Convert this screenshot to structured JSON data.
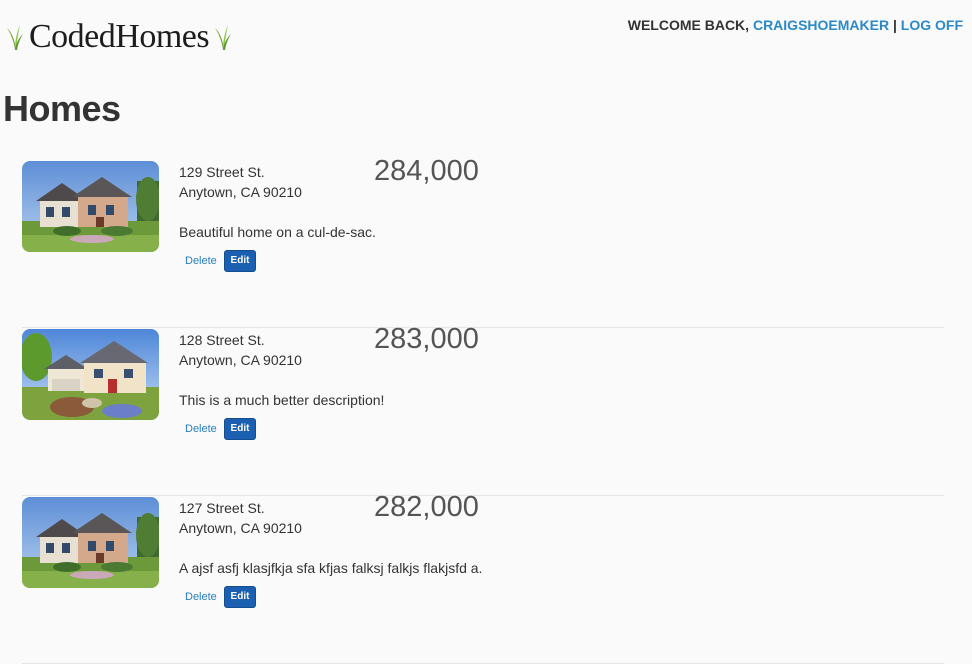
{
  "header": {
    "logo_text": "CodedHomes",
    "welcome_text": "WELCOME BACK,",
    "username": "CRAIGSHOEMAKER",
    "separator": "|",
    "logoff_label": "LOG OFF"
  },
  "page": {
    "title": "Homes"
  },
  "homes": [
    {
      "street": "129 Street St.",
      "city_line": "Anytown, CA 90210",
      "price": "284,000",
      "description": "Beautiful home on a cul-de-sac.",
      "delete_label": "Delete",
      "edit_label": "Edit",
      "image": "house-photo-1"
    },
    {
      "street": "128 Street St.",
      "city_line": "Anytown, CA 90210",
      "price": "283,000",
      "description": "This is a much better description!",
      "delete_label": "Delete",
      "edit_label": "Edit",
      "image": "house-photo-2"
    },
    {
      "street": "127 Street St.",
      "city_line": "Anytown, CA 90210",
      "price": "282,000",
      "description": "A ajsf asfj klasjfkja sfa kfjas falksj falkjs flakjsfd a.",
      "delete_label": "Delete",
      "edit_label": "Edit",
      "image": "house-photo-1"
    }
  ],
  "colors": {
    "link": "#2a8ac7",
    "edit_button": "#1b5fb0",
    "logo_grass": "#7cb342"
  }
}
